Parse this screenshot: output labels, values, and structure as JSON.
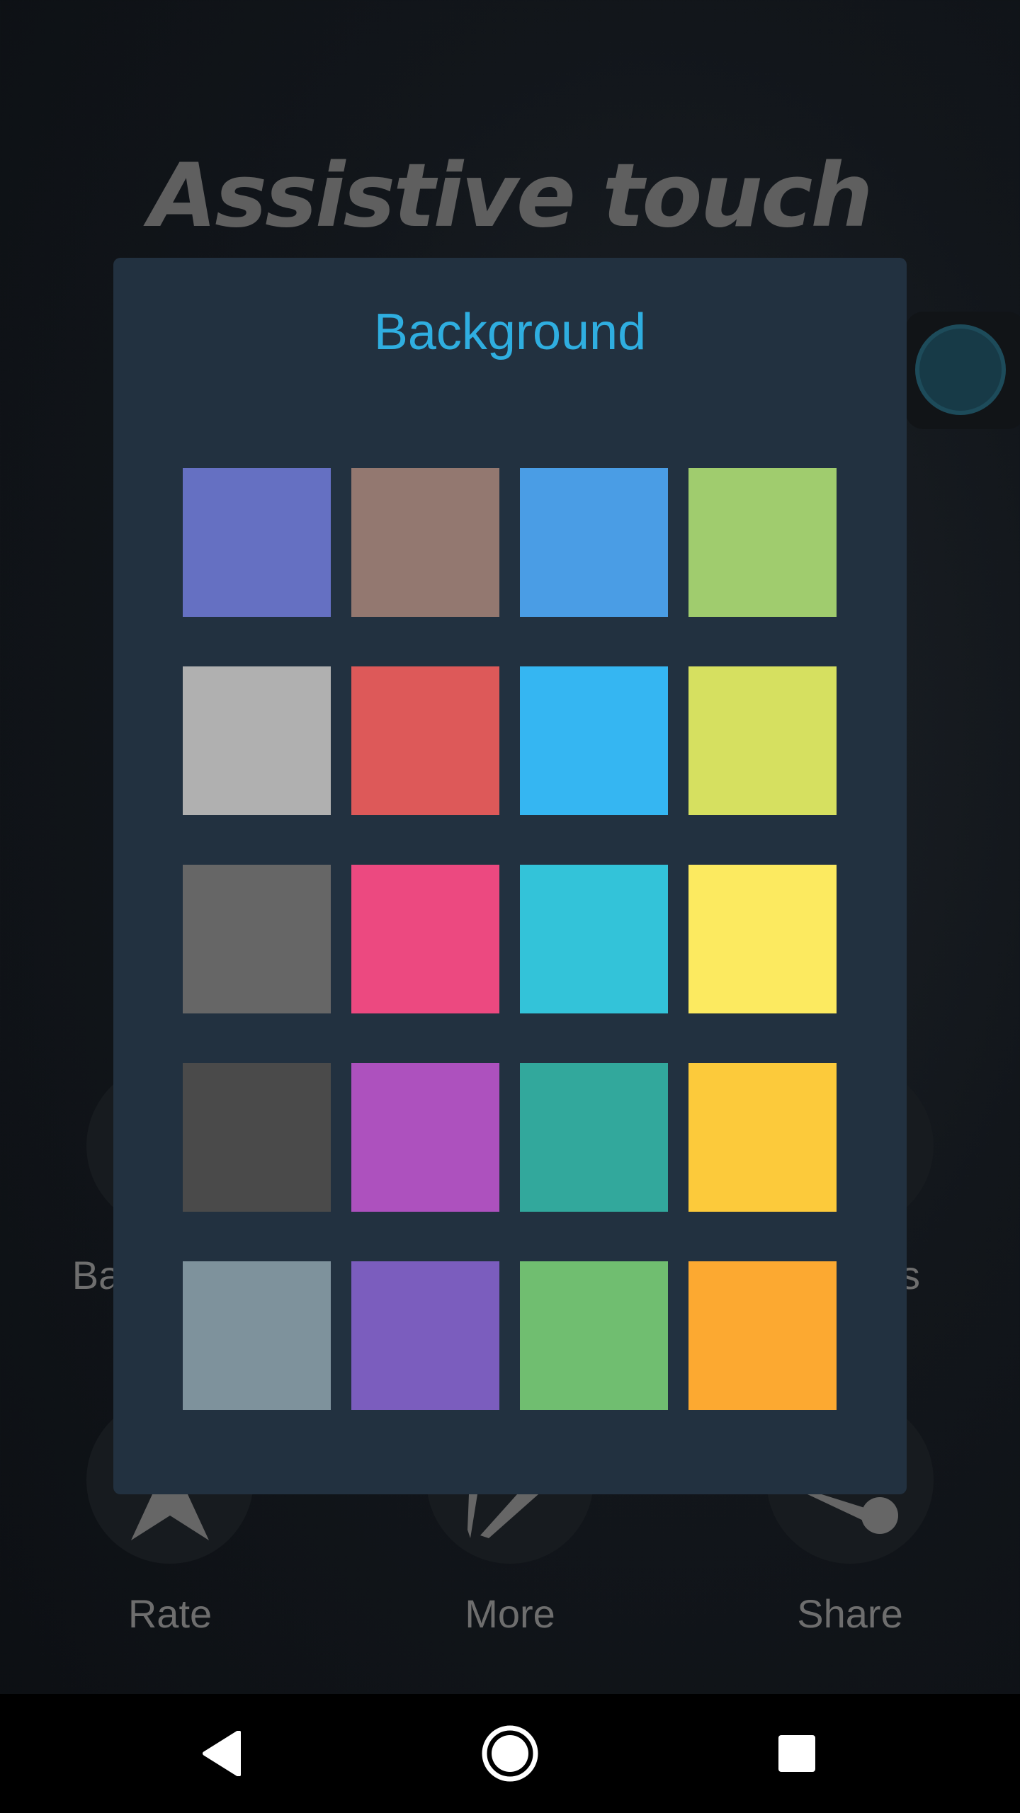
{
  "app": {
    "title": "Assistive touch"
  },
  "background_menu": {
    "partial_labels": [
      "Bac",
      "s"
    ],
    "items": [
      {
        "label": "Rate",
        "icon": "star-icon"
      },
      {
        "label": "More",
        "icon": "more-apps-icon"
      },
      {
        "label": "Share",
        "icon": "share-icon"
      }
    ]
  },
  "dialog": {
    "title": "Background",
    "title_color": "#2FAEE0",
    "colors": [
      "#6570C2",
      "#937870",
      "#4A9DE5",
      "#A0CC6E",
      "#B0B0B0",
      "#DD5959",
      "#35B6F2",
      "#D6E060",
      "#666666",
      "#EC4980",
      "#33C3D9",
      "#FCEA60",
      "#4A4A4A",
      "#AD51BE",
      "#32A89C",
      "#FCCA3B",
      "#7E929C",
      "#7B5DBE",
      "#70BE70",
      "#FCA931"
    ]
  },
  "navbar": {
    "buttons": [
      "back-icon",
      "home-icon",
      "recents-icon"
    ]
  }
}
